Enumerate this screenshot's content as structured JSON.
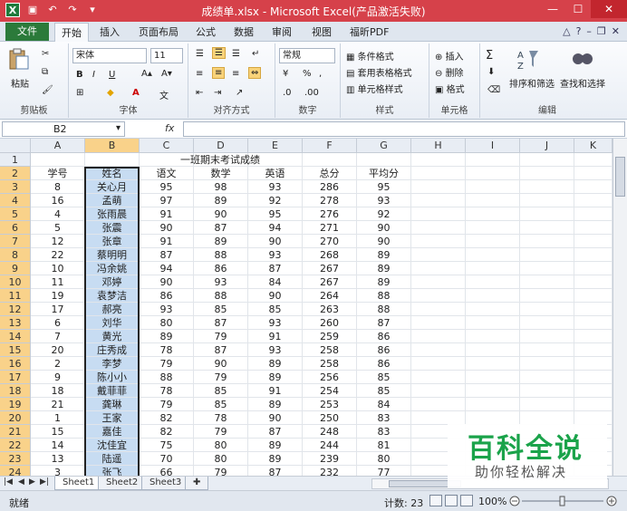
{
  "window": {
    "title": "成绩单.xlsx - Microsoft Excel(产品激活失败)"
  },
  "ribbon": {
    "file_tab": "文件",
    "tabs": [
      "开始",
      "插入",
      "页面布局",
      "公式",
      "数据",
      "审阅",
      "视图",
      "福昕PDF"
    ],
    "groups": {
      "clipboard": {
        "label": "剪贴板",
        "paste": "粘贴"
      },
      "font": {
        "label": "字体",
        "font_name": "宋体",
        "font_size": "11",
        "bold": "B",
        "italic": "I",
        "underline": "U"
      },
      "alignment": {
        "label": "对齐方式"
      },
      "number": {
        "label": "数字",
        "format": "常规",
        "percent": "%",
        "comma": ","
      },
      "styles": {
        "label": "样式",
        "conditional": "条件格式",
        "table": "套用表格格式",
        "cell_styles": "单元格样式"
      },
      "cells": {
        "label": "单元格",
        "insert": "插入",
        "delete": "删除",
        "format": "格式"
      },
      "editing": {
        "label": "编辑",
        "sort_filter": "排序和筛选",
        "find_select": "查找和选择",
        "sum": "Σ"
      }
    }
  },
  "formula_bar": {
    "name_box": "B2",
    "fx": "fx",
    "content": ""
  },
  "sheet": {
    "columns": [
      "A",
      "B",
      "C",
      "D",
      "E",
      "F",
      "G",
      "H",
      "I",
      "J",
      "K"
    ],
    "title": "一班期末考试成绩",
    "headers": [
      "学号",
      "姓名",
      "语文",
      "数学",
      "英语",
      "总分",
      "平均分"
    ],
    "rows": [
      [
        "8",
        "关心月",
        "95",
        "98",
        "93",
        "286",
        "95"
      ],
      [
        "16",
        "孟萌",
        "97",
        "89",
        "92",
        "278",
        "93"
      ],
      [
        "4",
        "张雨晨",
        "91",
        "90",
        "95",
        "276",
        "92"
      ],
      [
        "5",
        "张震",
        "90",
        "87",
        "94",
        "271",
        "90"
      ],
      [
        "12",
        "张章",
        "91",
        "89",
        "90",
        "270",
        "90"
      ],
      [
        "22",
        "蔡明明",
        "87",
        "88",
        "93",
        "268",
        "89"
      ],
      [
        "10",
        "冯余姚",
        "94",
        "86",
        "87",
        "267",
        "89"
      ],
      [
        "11",
        "邓婷",
        "90",
        "93",
        "84",
        "267",
        "89"
      ],
      [
        "19",
        "袁梦洁",
        "86",
        "88",
        "90",
        "264",
        "88"
      ],
      [
        "17",
        "郝亮",
        "93",
        "85",
        "85",
        "263",
        "88"
      ],
      [
        "6",
        "刘华",
        "80",
        "87",
        "93",
        "260",
        "87"
      ],
      [
        "7",
        "黄光",
        "89",
        "79",
        "91",
        "259",
        "86"
      ],
      [
        "20",
        "庄秀成",
        "78",
        "87",
        "93",
        "258",
        "86"
      ],
      [
        "2",
        "李梦",
        "79",
        "90",
        "89",
        "258",
        "86"
      ],
      [
        "9",
        "陈小小",
        "88",
        "79",
        "89",
        "256",
        "85"
      ],
      [
        "18",
        "戴菲菲",
        "78",
        "85",
        "91",
        "254",
        "85"
      ],
      [
        "21",
        "龚琳",
        "79",
        "85",
        "89",
        "253",
        "84"
      ],
      [
        "1",
        "王家",
        "82",
        "78",
        "90",
        "250",
        "83"
      ],
      [
        "15",
        "嘉佳",
        "82",
        "79",
        "87",
        "248",
        "83"
      ],
      [
        "14",
        "沈佳宜",
        "75",
        "80",
        "89",
        "244",
        "81"
      ],
      [
        "13",
        "陆遥",
        "70",
        "80",
        "89",
        "239",
        "80"
      ],
      [
        "3",
        "张飞",
        "66",
        "79",
        "87",
        "232",
        "77"
      ]
    ]
  },
  "sheet_tabs": [
    "Sheet1",
    "Sheet2",
    "Sheet3"
  ],
  "status": {
    "ready": "就绪",
    "count": "计数: 23",
    "zoom": "100%"
  },
  "watermark": {
    "line1": "百科全说",
    "line2": "助你轻松解决"
  }
}
